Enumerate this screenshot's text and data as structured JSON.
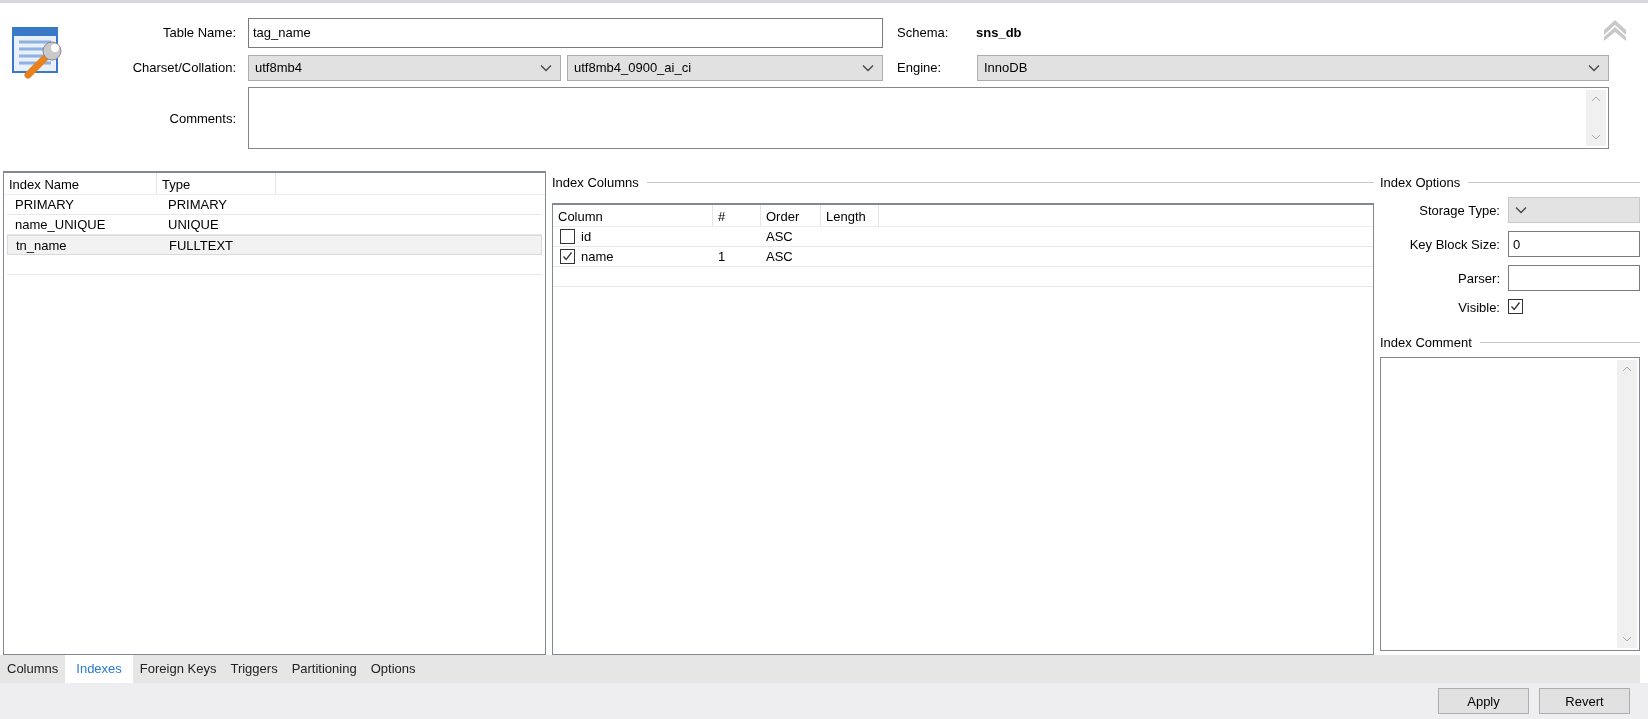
{
  "header": {
    "table_name_label": "Table Name:",
    "table_name": "tag_name",
    "schema_label": "Schema:",
    "schema": "sns_db",
    "charset_label": "Charset/Collation:",
    "charset": "utf8mb4",
    "collation": "utf8mb4_0900_ai_ci",
    "engine_label": "Engine:",
    "engine": "InnoDB",
    "comments_label": "Comments:"
  },
  "indexes": {
    "columns": [
      "Index Name",
      "Type"
    ],
    "rows": [
      {
        "name": "PRIMARY",
        "type": "PRIMARY",
        "selected": false
      },
      {
        "name": "name_UNIQUE",
        "type": "UNIQUE",
        "selected": false
      },
      {
        "name": "tn_name",
        "type": "FULLTEXT",
        "selected": true
      }
    ]
  },
  "index_columns": {
    "title": "Index Columns",
    "columns": [
      "Column",
      "#",
      "Order",
      "Length"
    ],
    "rows": [
      {
        "column": "id",
        "checked": false,
        "order": "ASC"
      },
      {
        "column": "name",
        "checked": true,
        "number": "1",
        "order": "ASC"
      }
    ]
  },
  "index_options": {
    "title": "Index Options",
    "storage_type_label": "Storage Type:",
    "key_block_size_label": "Key Block Size:",
    "key_block_size": "0",
    "parser_label": "Parser:",
    "visible_label": "Visible:",
    "visible": true,
    "comment_title": "Index Comment"
  },
  "tabs": [
    {
      "label": "Columns",
      "selected": false
    },
    {
      "label": "Indexes",
      "selected": true
    },
    {
      "label": "Foreign Keys",
      "selected": false
    },
    {
      "label": "Triggers",
      "selected": false
    },
    {
      "label": "Partitioning",
      "selected": false
    },
    {
      "label": "Options",
      "selected": false
    }
  ],
  "buttons": [
    "Apply",
    "Revert"
  ]
}
